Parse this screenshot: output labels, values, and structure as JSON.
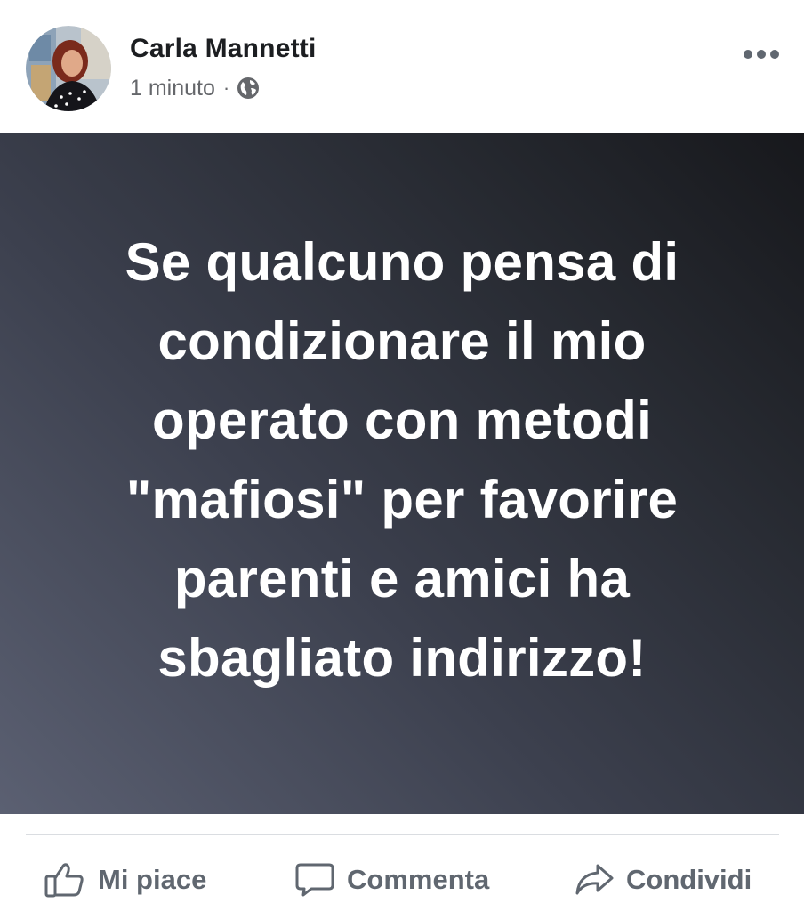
{
  "post": {
    "author_name": "Carla Mannetti",
    "timestamp": "1 minuto",
    "separator": "·",
    "privacy_icon": "globe-icon",
    "more_icon": "more-options-icon"
  },
  "status": {
    "text": "Se qualcuno pensa di\ncondizionare il mio\noperato con metodi\n\"mafiosi\" per favorire\nparenti e  amici ha\nsbagliato indirizzo!",
    "background_start": "#5b6072",
    "background_end": "#17181c",
    "text_color": "#ffffff"
  },
  "actions": {
    "like": {
      "label": "Mi piace",
      "icon": "thumbs-up-icon"
    },
    "comment": {
      "label": "Commenta",
      "icon": "comment-icon"
    },
    "share": {
      "label": "Condividi",
      "icon": "share-icon"
    }
  },
  "colors": {
    "name_text": "#1c1e21",
    "meta_text": "#65676b",
    "action_text": "#606770",
    "divider": "#dadde1"
  }
}
